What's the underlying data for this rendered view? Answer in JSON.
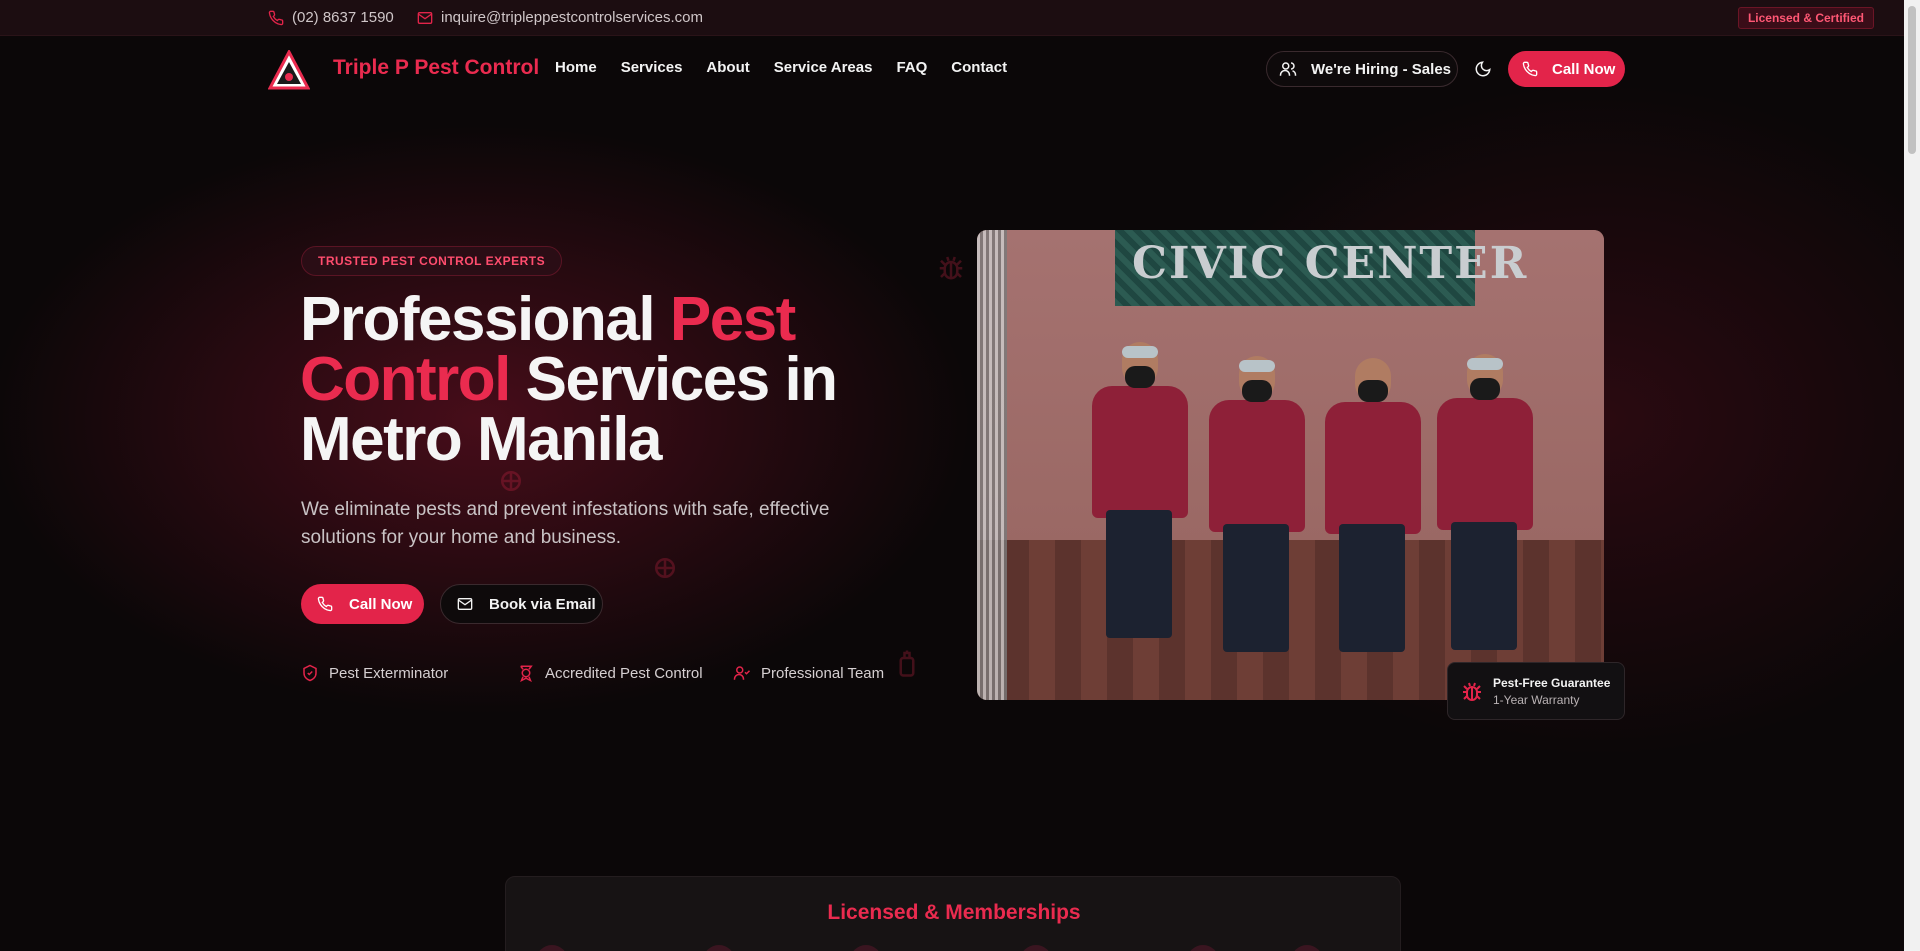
{
  "topbar": {
    "phone": "(02) 8637 1590",
    "email": "inquire@tripleppestcontrolservices.com",
    "badge": "Licensed & Certified"
  },
  "nav": {
    "brand": "Triple P Pest Control",
    "menu": [
      "Home",
      "Services",
      "About",
      "Service Areas",
      "FAQ",
      "Contact"
    ],
    "hiring_label": "We're Hiring - Sales",
    "call_label": "Call Now"
  },
  "hero": {
    "pill": "TRUSTED PEST CONTROL EXPERTS",
    "headline_part1": "Professional ",
    "headline_red1": "Pest Control",
    "headline_part2": " Services in Metro Manila",
    "subtitle": "We eliminate pests and prevent infestations with safe, effective solutions for your home and business.",
    "call_button": "Call Now",
    "email_button": "Book via Email",
    "features": [
      "Pest Exterminator",
      "Accredited Pest Control",
      "Professional Team"
    ]
  },
  "photo": {
    "sign_text": "CIVIC CENTER"
  },
  "guarantee": {
    "title": "Pest-Free Guarantee",
    "subtitle": "1-Year Warranty"
  },
  "memberships": {
    "title": "Licensed & Memberships"
  },
  "colors": {
    "accent": "#e3244a",
    "brand_red": "#ea2b4f",
    "background": "#0b0708"
  },
  "icons": {
    "phone": "phone-icon",
    "email": "mail-icon",
    "hiring": "users-icon",
    "theme": "moon-icon",
    "guarantee": "bug-icon"
  }
}
